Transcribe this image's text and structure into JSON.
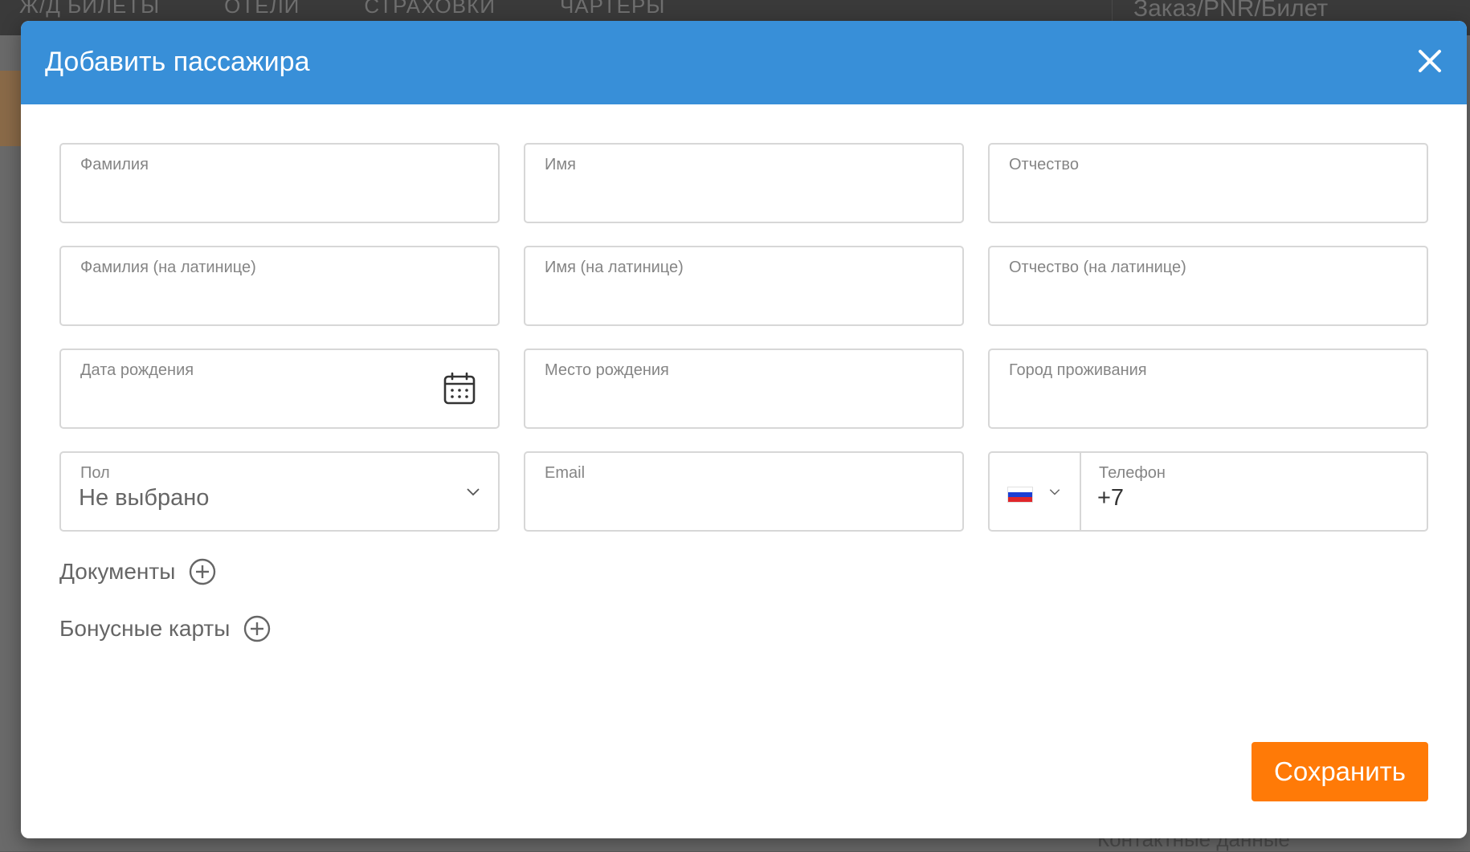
{
  "background": {
    "nav": [
      "Ж/Д БИЛЕТЫ",
      "ОТЕЛИ",
      "СТРАХОВКИ",
      "ЧАРТЕРЫ"
    ],
    "search_placeholder": "Заказ/PNR/Билет",
    "footer_text": "Контактные данные"
  },
  "modal": {
    "title": "Добавить пассажира",
    "close_icon": "close-icon",
    "fields": {
      "last_name": "Фамилия",
      "first_name": "Имя",
      "middle_name": "Отчество",
      "last_name_latin": "Фамилия (на латинице)",
      "first_name_latin": "Имя (на латинице)",
      "middle_name_latin": "Отчество (на латинице)",
      "birth_date": "Дата рождения",
      "birth_place": "Место рождения",
      "city": "Город проживания",
      "gender_label": "Пол",
      "gender_value": "Не выбрано",
      "email": "Email",
      "phone_label": "Телефон",
      "phone_value": "+7"
    },
    "phone_country": "ru-flag",
    "documents_label": "Документы",
    "bonus_cards_label": "Бонусные карты",
    "save_label": "Сохранить"
  },
  "colors": {
    "header": "#388fd8",
    "save_button": "#ff7a07",
    "field_border": "#d7d7d7"
  }
}
